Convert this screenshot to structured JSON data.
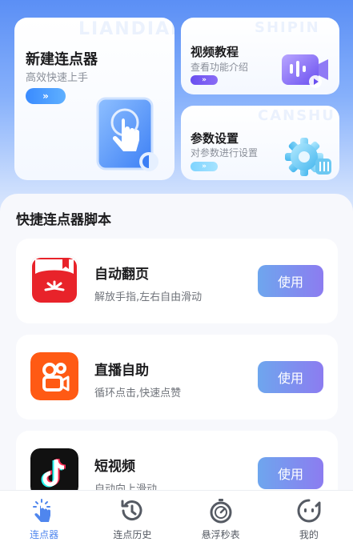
{
  "feature_cards": {
    "new_clicker": {
      "title": "新建连点器",
      "subtitle": "高效快速上手",
      "watermark": "LIANDIAN",
      "arrow": "»"
    },
    "video_tutorial": {
      "title": "视频教程",
      "subtitle": "查看功能介绍",
      "watermark": "SHIPIN",
      "arrow": "»"
    },
    "settings": {
      "title": "参数设置",
      "subtitle": "对参数进行设置",
      "watermark": "CANSHU",
      "arrow": "»"
    }
  },
  "section": {
    "title": "快捷连点器脚本"
  },
  "scripts": [
    {
      "title": "自动翻页",
      "subtitle": "解放手指,左右自由滑动",
      "button": "使用",
      "icon": "reader-app-icon",
      "color": "#e8232a"
    },
    {
      "title": "直播自助",
      "subtitle": "循环点击,快速点赞",
      "button": "使用",
      "icon": "kuaishou-app-icon",
      "color": "#ff5a14"
    },
    {
      "title": "短视频",
      "subtitle": "自动向上滑动",
      "button": "使用",
      "icon": "douyin-app-icon",
      "color": "#111111"
    }
  ],
  "tabbar": {
    "items": [
      {
        "label": "连点器",
        "icon": "tap-hand-icon",
        "active": true
      },
      {
        "label": "连点历史",
        "icon": "history-icon",
        "active": false
      },
      {
        "label": "悬浮秒表",
        "icon": "stopwatch-icon",
        "active": false
      },
      {
        "label": "我的",
        "icon": "profile-face-icon",
        "active": false
      }
    ]
  },
  "colors": {
    "accent": "#4f86ee",
    "button_start": "#6ea6ee",
    "button_end": "#8c7cf0"
  }
}
